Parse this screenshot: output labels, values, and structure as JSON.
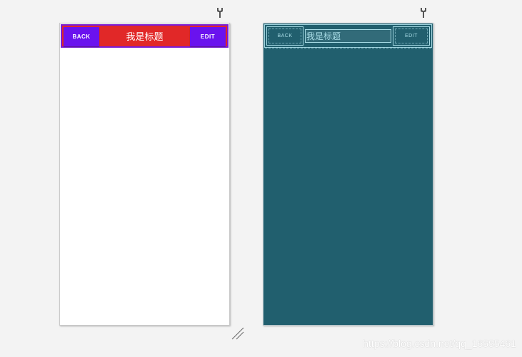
{
  "design_view": {
    "toolbar": {
      "back_label": "BACK",
      "title": "我是标题",
      "edit_label": "EDIT"
    },
    "colors": {
      "toolbar_bg": "#e12828",
      "button_bg": "#6a12ee",
      "text": "#ffffff",
      "content_bg": "#ffffff"
    }
  },
  "blueprint_view": {
    "toolbar": {
      "back_label": "BACK",
      "title": "我是标题",
      "edit_label": "EDIT"
    },
    "colors": {
      "bg": "#215f6e",
      "outline": "#a8dce6"
    }
  },
  "icons": {
    "design_tools": "wrench-icon",
    "blueprint_tools": "wrench-icon",
    "resize": "resize-handle-icon"
  },
  "watermark": "https://blog.csdn.net/qq_16555461"
}
